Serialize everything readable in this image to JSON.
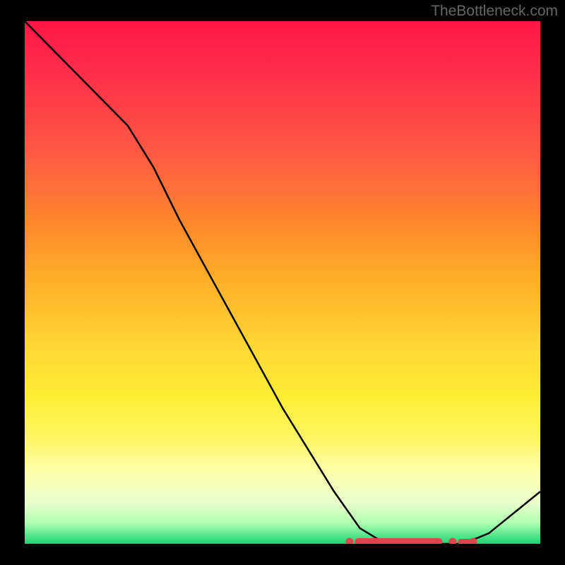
{
  "watermark": "TheBottleneck.com",
  "chart_data": {
    "type": "line",
    "title": "",
    "xlabel": "",
    "ylabel": "",
    "x": [
      0,
      5,
      10,
      15,
      20,
      25,
      30,
      35,
      40,
      45,
      50,
      55,
      60,
      65,
      70,
      75,
      80,
      85,
      90,
      95,
      100
    ],
    "values": [
      100,
      95,
      90,
      85,
      80,
      72,
      62,
      53,
      44,
      35,
      26,
      18,
      10,
      3,
      0,
      0,
      0,
      0,
      2,
      6,
      10
    ],
    "ylim": [
      0,
      100
    ],
    "xlim": [
      0,
      100
    ],
    "marker_range_x": [
      63,
      87
    ],
    "gradient_stops": [
      {
        "pct": 0,
        "color": "#ff1744"
      },
      {
        "pct": 50,
        "color": "#ffd633"
      },
      {
        "pct": 86,
        "color": "#ffffaa"
      },
      {
        "pct": 100,
        "color": "#20d070"
      }
    ]
  }
}
